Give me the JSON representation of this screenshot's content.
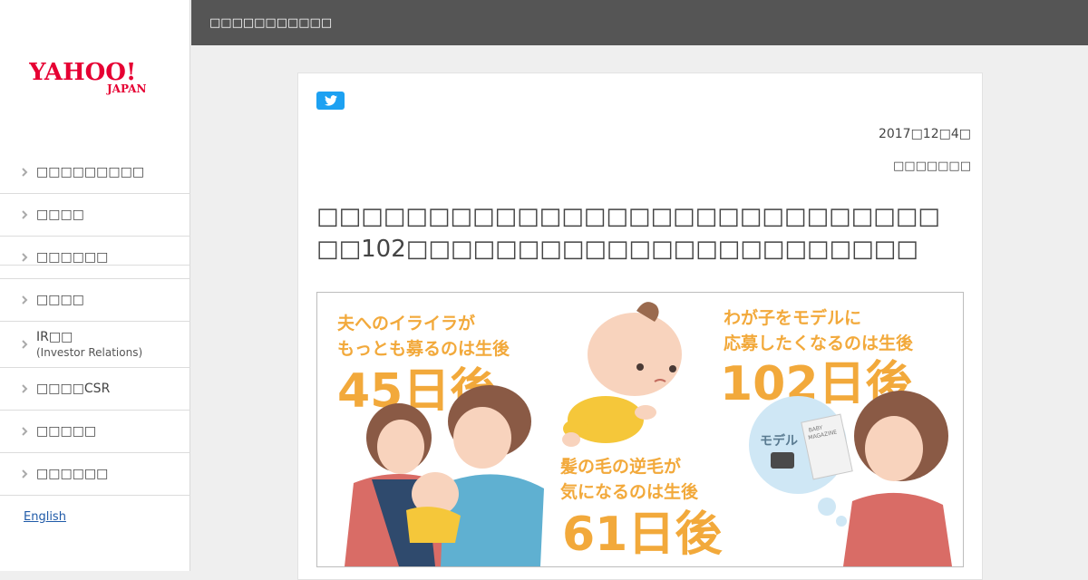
{
  "sidebar": {
    "logo_text": "YAHOO!",
    "logo_sub": "JAPAN",
    "items": [
      {
        "label": "□□□□□□□□□"
      },
      {
        "label": "□□□□"
      },
      {
        "label": "□□□□□□"
      },
      {
        "label": "□□□□"
      },
      {
        "label": "IR□□",
        "sub": "(Investor Relations)"
      },
      {
        "label": "□□□□CSR"
      },
      {
        "label": "□□□□□"
      },
      {
        "label": "□□□□□□"
      }
    ],
    "english": "English"
  },
  "header": {
    "title": "□□□□□□□□□□□"
  },
  "article": {
    "date": "2017□12□4□",
    "department": "□□□□□□□",
    "headline_line1": "□□□□□□□□□□□□□□□□□□□□□□□□□□□□",
    "headline_line2": "□□102□□□□□□□□□□□□□□□□□□□□□□□"
  },
  "hero": {
    "t1_line1": "夫へのイライラが",
    "t1_line2": "もっとも募るのは生後",
    "t1_big": "45日後",
    "t2_line1": "わが子をモデルに",
    "t2_line2": "応募したくなるのは生後",
    "t2_big": "102日後",
    "t3_line1": "髪の毛の逆毛が",
    "t3_line2": "気になるのは生後",
    "t3_big": "61日後",
    "bubble_model": "モデル",
    "magazine_line1": "BABY",
    "magazine_line2": "MAGAZINE"
  },
  "colors": {
    "header_bg": "#555555",
    "accent_orange": "#f2a93b",
    "twitter_blue": "#1da1f2",
    "logo_red": "#e60033",
    "link_blue": "#1f5aa8"
  },
  "icons": [
    "yahoo-japan-logo",
    "chevron-right-icon",
    "twitter-icon"
  ]
}
